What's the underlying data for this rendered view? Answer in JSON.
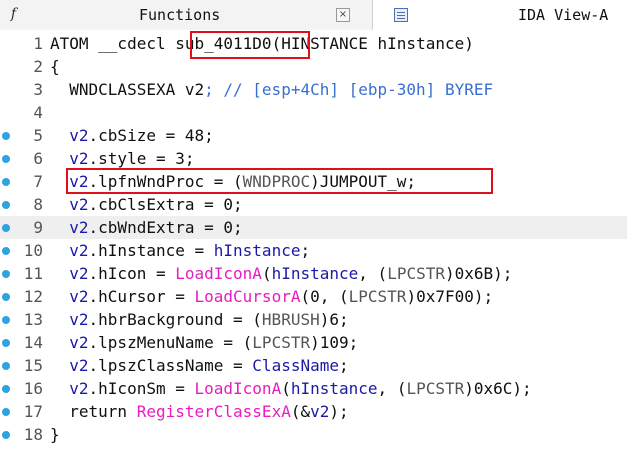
{
  "tabs": {
    "functions": {
      "icon": "function-icon",
      "label": "Functions",
      "close": "×"
    },
    "ida_view": {
      "icon": "listing-view-icon",
      "label": "IDA View-A"
    }
  },
  "colors": {
    "breakpoint": "#2ea3e0",
    "function_name": "#e81cc2",
    "variable": "#1a1aa6",
    "comment": "#3a6fd1",
    "highlight_box": "#e0101a"
  },
  "code": {
    "lines": [
      {
        "num": "1",
        "bp": false,
        "hl": false,
        "tokens": [
          {
            "t": "ATOM __cdecl ",
            "c": "t-plain"
          },
          {
            "t": "sub_4011D0",
            "c": "t-plain"
          },
          {
            "t": "(HINSTANCE ",
            "c": "t-plain"
          },
          {
            "t": "hInstance",
            "c": "t-plain"
          },
          {
            "t": ")",
            "c": "t-plain"
          }
        ]
      },
      {
        "num": "2",
        "bp": false,
        "hl": false,
        "tokens": [
          {
            "t": "{",
            "c": "t-plain"
          }
        ]
      },
      {
        "num": "3",
        "bp": false,
        "hl": false,
        "tokens": [
          {
            "t": "  WNDCLASSEXA ",
            "c": "t-plain"
          },
          {
            "t": "v2",
            "c": "t-plain"
          },
          {
            "t": "; // [esp+4Ch] [ebp-30h] BYREF",
            "c": "t-cm"
          }
        ]
      },
      {
        "num": "4",
        "bp": false,
        "hl": false,
        "tokens": [
          {
            "t": "",
            "c": "t-plain"
          }
        ]
      },
      {
        "num": "5",
        "bp": true,
        "hl": false,
        "tokens": [
          {
            "t": "  v2",
            "c": "t-var"
          },
          {
            "t": ".cbSize = 48;",
            "c": "t-plain"
          }
        ]
      },
      {
        "num": "6",
        "bp": true,
        "hl": false,
        "tokens": [
          {
            "t": "  v2",
            "c": "t-var"
          },
          {
            "t": ".style = 3;",
            "c": "t-plain"
          }
        ]
      },
      {
        "num": "7",
        "bp": true,
        "hl": false,
        "tokens": [
          {
            "t": "  v2",
            "c": "t-var"
          },
          {
            "t": ".lpfnWndProc = (",
            "c": "t-plain"
          },
          {
            "t": "WNDPROC",
            "c": "t-gray"
          },
          {
            "t": ")JUMPOUT_w;",
            "c": "t-plain"
          }
        ]
      },
      {
        "num": "8",
        "bp": true,
        "hl": false,
        "tokens": [
          {
            "t": "  v2",
            "c": "t-var"
          },
          {
            "t": ".cbClsExtra = 0;",
            "c": "t-plain"
          }
        ]
      },
      {
        "num": "9",
        "bp": true,
        "hl": true,
        "tokens": [
          {
            "t": "  v2",
            "c": "t-var"
          },
          {
            "t": ".cbWndExtra = 0;",
            "c": "t-plain"
          }
        ]
      },
      {
        "num": "10",
        "bp": true,
        "hl": false,
        "tokens": [
          {
            "t": "  v2",
            "c": "t-var"
          },
          {
            "t": ".hInstance = ",
            "c": "t-plain"
          },
          {
            "t": "hInstance",
            "c": "t-var"
          },
          {
            "t": ";",
            "c": "t-plain"
          }
        ]
      },
      {
        "num": "11",
        "bp": true,
        "hl": false,
        "tokens": [
          {
            "t": "  v2",
            "c": "t-var"
          },
          {
            "t": ".hIcon = ",
            "c": "t-plain"
          },
          {
            "t": "LoadIconA",
            "c": "t-func"
          },
          {
            "t": "(",
            "c": "t-plain"
          },
          {
            "t": "hInstance",
            "c": "t-var"
          },
          {
            "t": ", (",
            "c": "t-plain"
          },
          {
            "t": "LPCSTR",
            "c": "t-gray"
          },
          {
            "t": ")0x6B);",
            "c": "t-plain"
          }
        ]
      },
      {
        "num": "12",
        "bp": true,
        "hl": false,
        "tokens": [
          {
            "t": "  v2",
            "c": "t-var"
          },
          {
            "t": ".hCursor = ",
            "c": "t-plain"
          },
          {
            "t": "LoadCursorA",
            "c": "t-func"
          },
          {
            "t": "(0, (",
            "c": "t-plain"
          },
          {
            "t": "LPCSTR",
            "c": "t-gray"
          },
          {
            "t": ")0x7F00);",
            "c": "t-plain"
          }
        ]
      },
      {
        "num": "13",
        "bp": true,
        "hl": false,
        "tokens": [
          {
            "t": "  v2",
            "c": "t-var"
          },
          {
            "t": ".hbrBackground = (",
            "c": "t-plain"
          },
          {
            "t": "HBRUSH",
            "c": "t-gray"
          },
          {
            "t": ")6;",
            "c": "t-plain"
          }
        ]
      },
      {
        "num": "14",
        "bp": true,
        "hl": false,
        "tokens": [
          {
            "t": "  v2",
            "c": "t-var"
          },
          {
            "t": ".lpszMenuName = (",
            "c": "t-plain"
          },
          {
            "t": "LPCSTR",
            "c": "t-gray"
          },
          {
            "t": ")109;",
            "c": "t-plain"
          }
        ]
      },
      {
        "num": "15",
        "bp": true,
        "hl": false,
        "tokens": [
          {
            "t": "  v2",
            "c": "t-var"
          },
          {
            "t": ".lpszClassName = ",
            "c": "t-plain"
          },
          {
            "t": "ClassName",
            "c": "t-var"
          },
          {
            "t": ";",
            "c": "t-plain"
          }
        ]
      },
      {
        "num": "16",
        "bp": true,
        "hl": false,
        "tokens": [
          {
            "t": "  v2",
            "c": "t-var"
          },
          {
            "t": ".hIconSm = ",
            "c": "t-plain"
          },
          {
            "t": "LoadIconA",
            "c": "t-func"
          },
          {
            "t": "(",
            "c": "t-plain"
          },
          {
            "t": "hInstance",
            "c": "t-var"
          },
          {
            "t": ", (",
            "c": "t-plain"
          },
          {
            "t": "LPCSTR",
            "c": "t-gray"
          },
          {
            "t": ")0x6C);",
            "c": "t-plain"
          }
        ]
      },
      {
        "num": "17",
        "bp": true,
        "hl": false,
        "tokens": [
          {
            "t": "  return ",
            "c": "t-plain"
          },
          {
            "t": "RegisterClassExA",
            "c": "t-func"
          },
          {
            "t": "(&",
            "c": "t-plain"
          },
          {
            "t": "v2",
            "c": "t-var"
          },
          {
            "t": ");",
            "c": "t-plain"
          }
        ]
      },
      {
        "num": "18",
        "bp": true,
        "hl": false,
        "tokens": [
          {
            "t": "}",
            "c": "t-plain"
          }
        ]
      }
    ]
  }
}
